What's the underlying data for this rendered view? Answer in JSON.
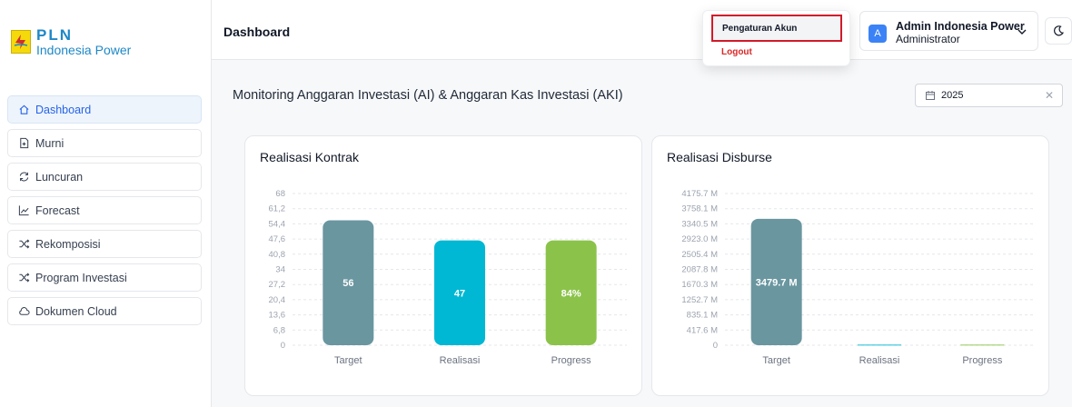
{
  "logo": {
    "brand": "PLN",
    "subtitle": "Indonesia Power"
  },
  "sidebar": {
    "items": [
      {
        "label": "Dashboard",
        "icon": "home-icon",
        "active": true
      },
      {
        "label": "Murni",
        "icon": "file-plus-icon"
      },
      {
        "label": "Luncuran",
        "icon": "refresh-icon"
      },
      {
        "label": "Forecast",
        "icon": "trend-icon"
      },
      {
        "label": "Rekomposisi",
        "icon": "shuffle-icon"
      },
      {
        "label": "Program Investasi",
        "icon": "shuffle-icon"
      },
      {
        "label": "Dokumen Cloud",
        "icon": "cloud-icon"
      }
    ]
  },
  "header": {
    "title": "Dashboard",
    "user": {
      "initial": "A",
      "name": "Admin Indonesia Power",
      "role": "Administrator"
    }
  },
  "dropdown": {
    "settings_label": "Pengaturan Akun",
    "logout_label": "Logout"
  },
  "main": {
    "title": "Monitoring Anggaran Investasi (AI) & Anggaran Kas Investasi (AKI)",
    "year": "2025"
  },
  "colors": {
    "target": "#6a96a0",
    "realisasi": "#00b8d4",
    "progress": "#8bc34a",
    "accent": "#3b82f6"
  },
  "chart_data": [
    {
      "type": "bar",
      "title": "Realisasi Kontrak",
      "categories": [
        "Target",
        "Realisasi",
        "Progress"
      ],
      "values": [
        56,
        47,
        47
      ],
      "data_labels": [
        "56",
        "47",
        "84%"
      ],
      "y_ticks": [
        "0",
        "6,8",
        "13,6",
        "20,4",
        "27,2",
        "34",
        "40,8",
        "47,6",
        "54,4",
        "61,2",
        "68"
      ],
      "ylim": [
        0,
        68
      ],
      "grid": true
    },
    {
      "type": "bar",
      "title": "Realisasi Disburse",
      "categories": [
        "Target",
        "Realisasi",
        "Progress"
      ],
      "values": [
        3479.7,
        0,
        0
      ],
      "data_labels": [
        "3479.7 M",
        "",
        ""
      ],
      "y_ticks": [
        "0",
        "417.6 M",
        "835.1 M",
        "1252.7 M",
        "1670.3 M",
        "2087.8 M",
        "2505.4 M",
        "2923.0 M",
        "3340.5 M",
        "3758.1 M",
        "4175.7 M"
      ],
      "ylim": [
        0,
        4175.7
      ],
      "grid": true
    }
  ]
}
